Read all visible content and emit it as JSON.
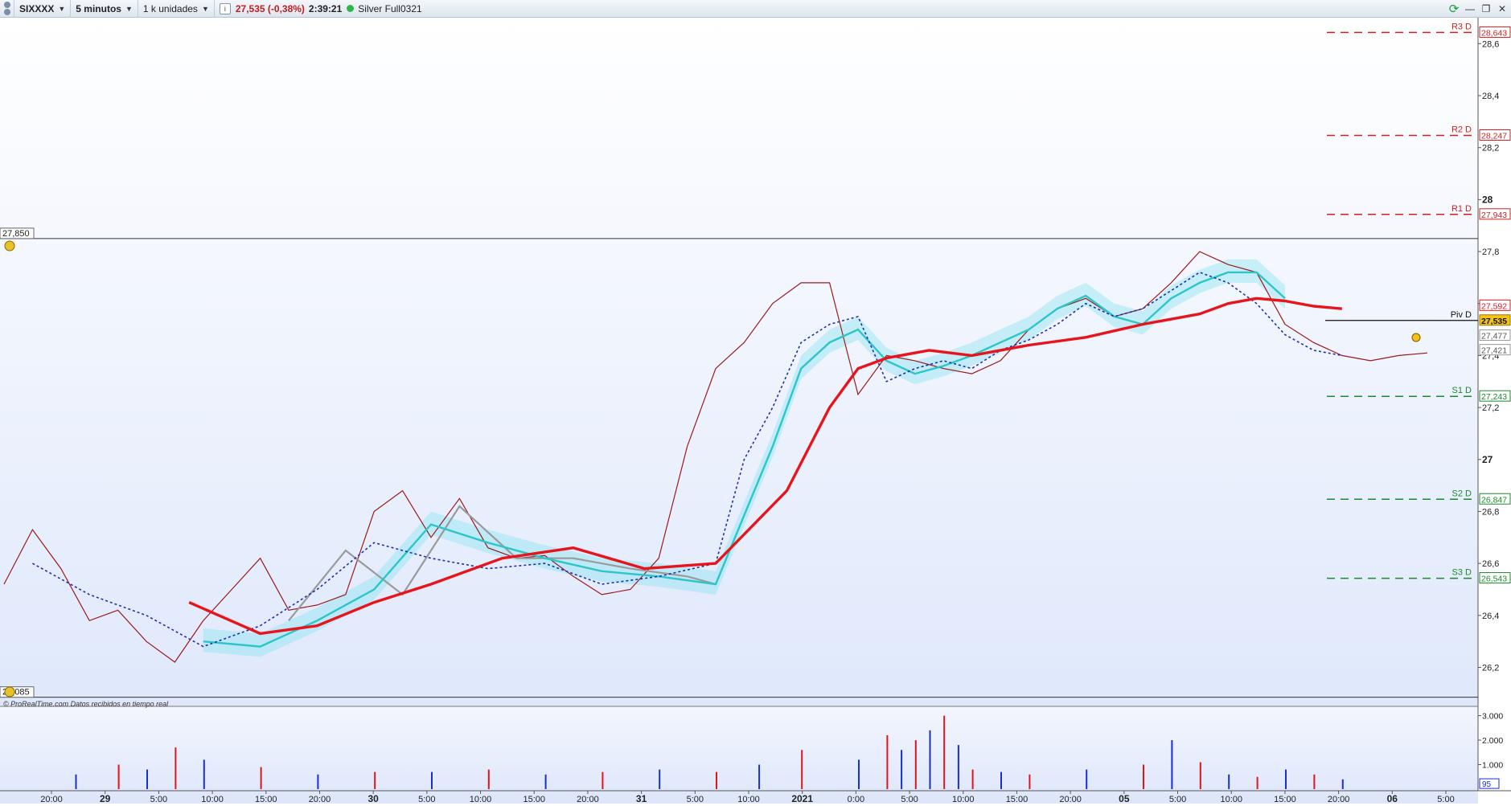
{
  "toolbar": {
    "symbol": "SIXXXX",
    "timeframe": "5 minutos",
    "units": "1 k unidades",
    "price_change": "27,535 (-0,38%)",
    "time": "2:39:21",
    "feed": "Silver Full0321"
  },
  "window": {
    "minimize": "—",
    "restore": "❐",
    "close": "✕"
  },
  "colors": {
    "ma_long": "#e8141c",
    "ma_fast": "#2ec5c9",
    "ma_slow": "#9a9a9a",
    "price": "#9b1b1b",
    "resistance": "#d02020",
    "support": "#1c8a2a",
    "vol_up": "#1a2fcf",
    "vol_down": "#e0141c"
  },
  "chart_data": {
    "type": "line",
    "title": "",
    "yticks": [
      "28,6",
      "28,4",
      "28,2",
      "28",
      "27,8",
      "27,6",
      "27,4",
      "27,2",
      "27",
      "26,8",
      "26,6",
      "26,4",
      "26,2"
    ],
    "xticks": [
      "20:00",
      "29",
      "5:00",
      "10:00",
      "15:00",
      "20:00",
      "30",
      "5:00",
      "10:00",
      "15:00",
      "20:00",
      "31",
      "5:00",
      "10:00",
      "2021",
      "0:00",
      "5:00",
      "10:00",
      "15:00",
      "20:00",
      "05",
      "5:00",
      "10:00",
      "15:00",
      "20:00",
      "06",
      "5:00"
    ],
    "ylim": [
      26.05,
      28.7
    ],
    "zone_top": "27,850",
    "zone_bottom": "26,085",
    "pivots": [
      {
        "name": "R3 D",
        "value": 28.643,
        "label": "28,643",
        "kind": "resistance"
      },
      {
        "name": "R2 D",
        "value": 28.247,
        "label": "28,247",
        "kind": "resistance"
      },
      {
        "name": "R1 D",
        "value": 27.943,
        "label": "27,943",
        "kind": "resistance"
      },
      {
        "name": "Piv D",
        "value": 27.535,
        "label": "27,535",
        "kind": "pivot"
      },
      {
        "name": "S1 D",
        "value": 27.243,
        "label": "27,243",
        "kind": "support"
      },
      {
        "name": "S2 D",
        "value": 26.847,
        "label": "26,847",
        "kind": "support"
      },
      {
        "name": "S3 D",
        "value": 26.543,
        "label": "26,543",
        "kind": "support"
      }
    ],
    "price_labels": [
      {
        "value": 27.592,
        "label": "27,592",
        "kind": "ma"
      },
      {
        "value": 27.535,
        "label": "27,535",
        "kind": "last"
      },
      {
        "value": 27.477,
        "label": "27,477",
        "kind": "plain"
      },
      {
        "value": 27.421,
        "label": "27,421",
        "kind": "plain"
      }
    ],
    "series": [
      {
        "name": "price",
        "x": [
          0,
          2,
          4,
          6,
          8,
          10,
          12,
          14,
          16,
          18,
          20,
          22,
          24,
          26,
          28,
          30,
          32,
          34,
          36,
          38,
          40,
          42,
          44,
          46,
          48,
          50,
          52,
          54,
          56,
          58,
          60,
          62,
          64,
          66,
          68,
          70,
          72,
          74,
          76,
          78,
          80,
          82,
          84,
          86,
          88,
          90,
          92,
          94,
          96,
          98,
          100
        ],
        "values": [
          26.52,
          26.73,
          26.58,
          26.38,
          26.42,
          26.3,
          26.22,
          26.38,
          26.5,
          26.62,
          26.42,
          26.44,
          26.48,
          26.8,
          26.88,
          26.7,
          26.85,
          26.66,
          26.62,
          26.63,
          26.55,
          26.48,
          26.5,
          26.62,
          27.05,
          27.35,
          27.45,
          27.6,
          27.68,
          27.68,
          27.25,
          27.4,
          27.38,
          27.35,
          27.33,
          27.38,
          27.5,
          27.58,
          27.62,
          27.55,
          27.58,
          27.68,
          27.8,
          27.75,
          27.72,
          27.52,
          27.45,
          27.4,
          27.38,
          27.4,
          27.41
        ]
      },
      {
        "name": "ma_long",
        "x": [
          13,
          18,
          22,
          26,
          30,
          35,
          40,
          45,
          50,
          55,
          58,
          60,
          62,
          65,
          68,
          72,
          76,
          80,
          84,
          86,
          88,
          90,
          92,
          94
        ],
        "values": [
          26.45,
          26.33,
          26.36,
          26.45,
          26.52,
          26.62,
          26.66,
          26.58,
          26.6,
          26.88,
          27.2,
          27.35,
          27.39,
          27.42,
          27.4,
          27.44,
          27.47,
          27.52,
          27.56,
          27.6,
          27.62,
          27.61,
          27.59,
          27.58
        ]
      },
      {
        "name": "ma_fast",
        "x": [
          14,
          18,
          22,
          26,
          30,
          34,
          38,
          42,
          46,
          50,
          54,
          56,
          58,
          60,
          62,
          64,
          66,
          68,
          70,
          72,
          74,
          76,
          78,
          80,
          82,
          84,
          86,
          88,
          90
        ],
        "values": [
          26.3,
          26.28,
          26.38,
          26.5,
          26.75,
          26.68,
          26.62,
          26.57,
          26.55,
          26.52,
          27.05,
          27.35,
          27.45,
          27.5,
          27.38,
          27.33,
          27.36,
          27.4,
          27.45,
          27.5,
          27.58,
          27.63,
          27.55,
          27.52,
          27.62,
          27.68,
          27.72,
          27.72,
          27.62
        ]
      },
      {
        "name": "ma_slow",
        "x": [
          20,
          24,
          28,
          32,
          36,
          40,
          44,
          48,
          50
        ],
        "values": [
          26.38,
          26.65,
          26.48,
          26.82,
          26.62,
          26.62,
          26.58,
          26.55,
          26.52
        ]
      },
      {
        "name": "dotted",
        "x": [
          2,
          6,
          10,
          14,
          18,
          22,
          26,
          30,
          34,
          38,
          42,
          46,
          50,
          52,
          54,
          56,
          58,
          60,
          62,
          64,
          66,
          68,
          70,
          72,
          74,
          76,
          78,
          80,
          82,
          84,
          86,
          88,
          90,
          92,
          94
        ],
        "values": [
          26.6,
          26.48,
          26.4,
          26.28,
          26.36,
          26.5,
          26.68,
          26.62,
          26.58,
          26.6,
          26.52,
          26.55,
          26.6,
          27.0,
          27.2,
          27.45,
          27.52,
          27.55,
          27.3,
          27.35,
          27.38,
          27.35,
          27.42,
          27.46,
          27.52,
          27.6,
          27.55,
          27.58,
          27.65,
          27.72,
          27.68,
          27.6,
          27.48,
          27.42,
          27.4
        ]
      }
    ],
    "volume": {
      "yticks": [
        "3.000",
        "2.000",
        "1.000"
      ],
      "last_label": "95",
      "x": [
        5,
        8,
        10,
        12,
        14,
        18,
        22,
        26,
        30,
        34,
        38,
        42,
        46,
        50,
        53,
        56,
        60,
        62,
        63,
        64,
        65,
        66,
        67,
        68,
        70,
        72,
        76,
        80,
        82,
        84,
        86,
        88,
        90,
        92,
        94
      ],
      "values": [
        600,
        1000,
        800,
        1700,
        1200,
        900,
        600,
        700,
        700,
        800,
        600,
        700,
        800,
        700,
        1000,
        1600,
        1200,
        2200,
        1600,
        2000,
        2400,
        3000,
        1800,
        800,
        700,
        600,
        800,
        1000,
        2000,
        1100,
        600,
        500,
        800,
        600,
        400
      ]
    },
    "footer": "© ProRealTime.com  Datos recibidos en tiempo real"
  }
}
